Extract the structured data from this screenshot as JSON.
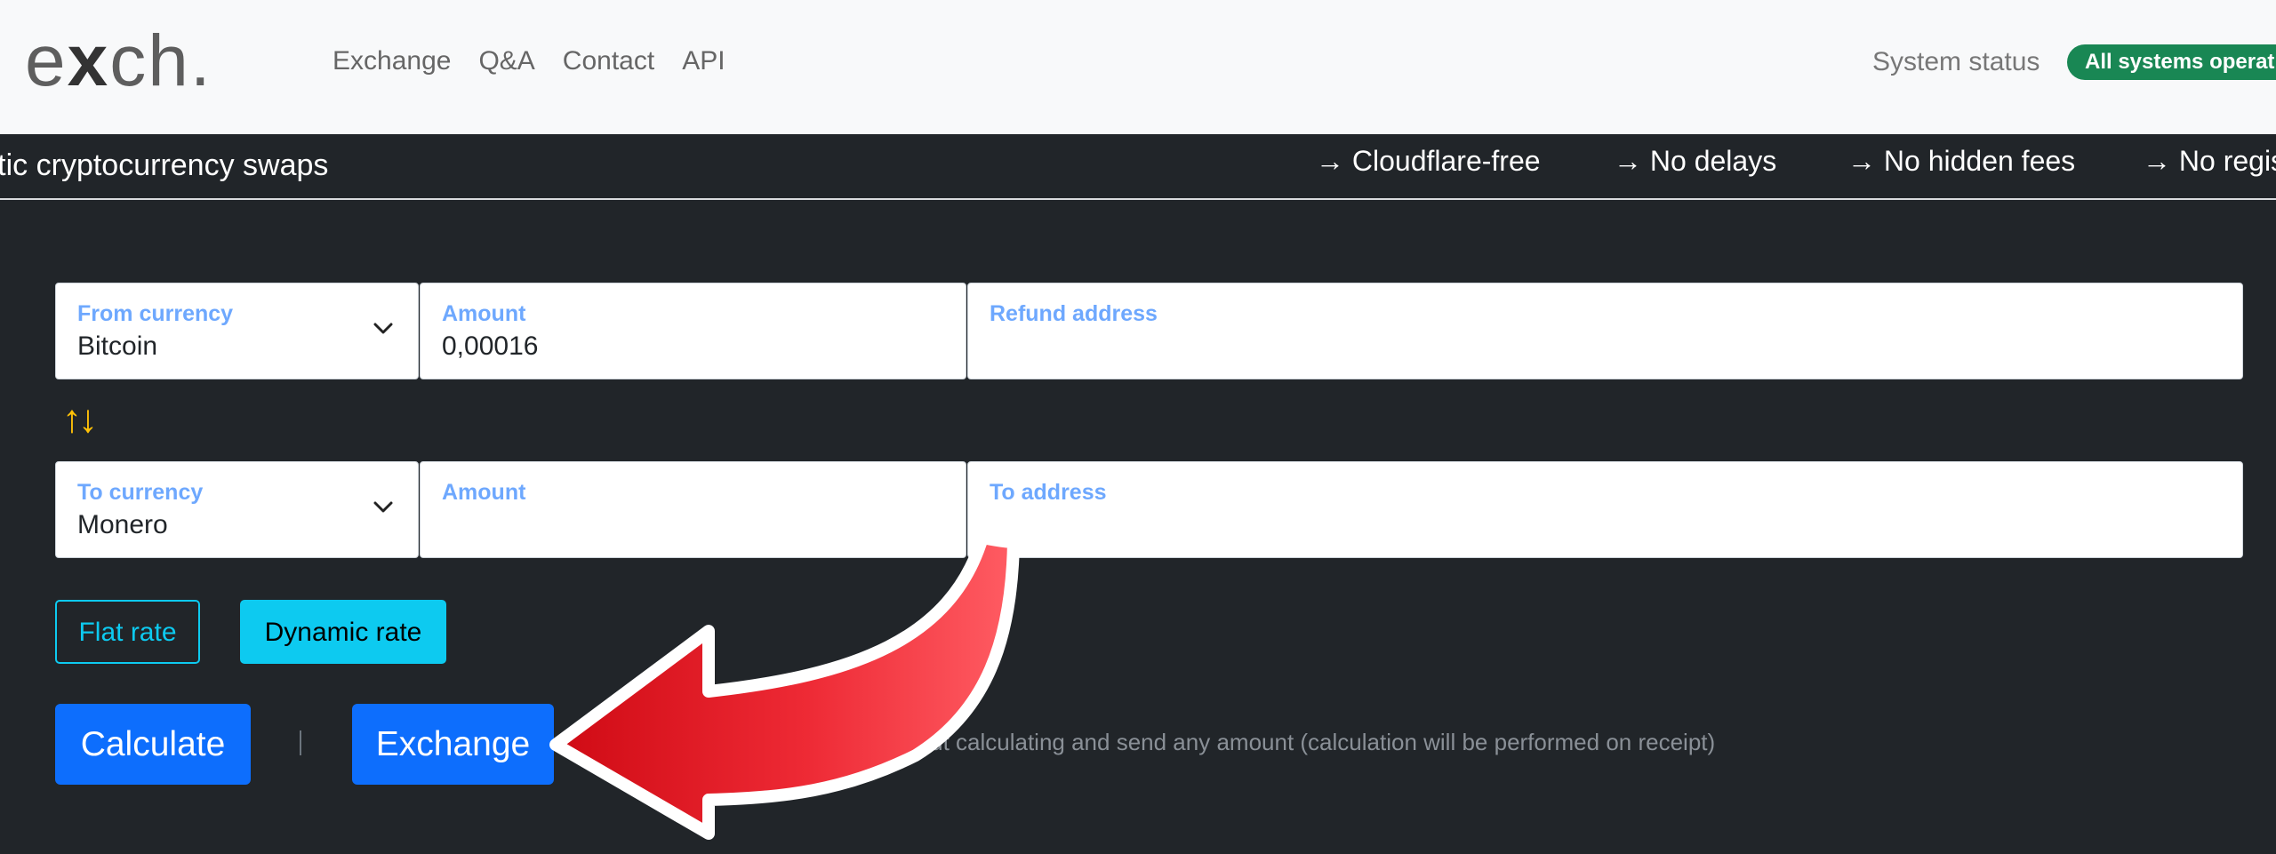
{
  "brand": {
    "logo_pre": "e",
    "logo_x": "x",
    "logo_post": "ch."
  },
  "nav": {
    "links": [
      "Exchange",
      "Q&A",
      "Contact",
      "API"
    ],
    "status_label": "System status",
    "status_badge": "All systems operational"
  },
  "marquee": {
    "tagline": "Automatic cryptocurrency swaps",
    "features": [
      "→ Cloudflare-free",
      "→ No delays",
      "→ No hidden fees",
      "→ No registration"
    ]
  },
  "form": {
    "from_currency": {
      "label": "From currency",
      "value": "Bitcoin"
    },
    "from_amount": {
      "label": "Amount",
      "value": "0,00016"
    },
    "refund_address": {
      "label": "Refund address",
      "value": ""
    },
    "swap_arrows": "↑↓",
    "to_currency": {
      "label": "To currency",
      "value": "Monero"
    },
    "to_amount": {
      "label": "Amount",
      "value": ""
    },
    "to_address": {
      "label": "To address",
      "value": ""
    },
    "flat_rate": "Flat rate",
    "dynamic_rate": "Dynamic rate",
    "calculate": "Calculate",
    "exchange": "Exchange",
    "hint": "mout calculating and send any amount (calculation will be performed on receipt)"
  },
  "colors": {
    "accent_blue": "#0d6efd",
    "cyan": "#0dcaf0",
    "label_blue": "#6ea8fe",
    "swap_yellow": "#ffc107",
    "status_green": "#198754",
    "arrow_red": "#e8182a"
  }
}
